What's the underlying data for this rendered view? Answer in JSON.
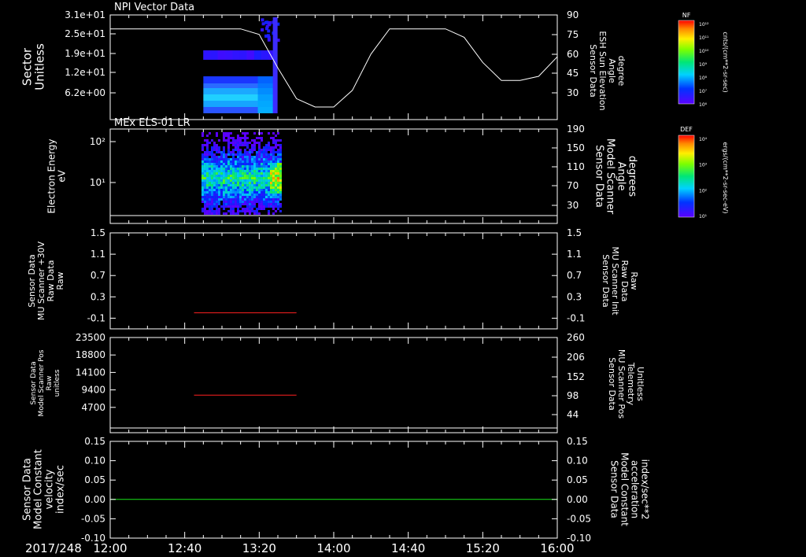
{
  "colors": {
    "white": "#ffffff",
    "red": "#ff2020",
    "green": "#19e619",
    "background": "#000000"
  },
  "time_axis": {
    "date": "2017/248",
    "ticks": [
      "12:00",
      "12:40",
      "13:20",
      "14:00",
      "14:40",
      "15:20",
      "16:00"
    ],
    "range": [
      "12:00",
      "16:00"
    ]
  },
  "chart_data": [
    {
      "type": "heatmap",
      "title": "NPI Vector Data",
      "ylabel": [
        "Sector",
        "Unitless"
      ],
      "y_ticks": [
        "3.1e+01",
        "2.5e+01",
        "1.9e+01",
        "1.2e+01",
        "6.2e+00"
      ],
      "y_range": [
        0,
        31
      ],
      "right_ylabel": [
        "Sensor Data",
        "ESH Sun Elevation",
        "Angle",
        "degree"
      ],
      "right_y_ticks": [
        "90",
        "75",
        "60",
        "45",
        "30"
      ],
      "right_y_range": [
        15,
        90
      ],
      "colorbar": {
        "label": "NF",
        "units": "cnts/(cm**2-sr-sec)",
        "ticks": [
          "10¹²",
          "10¹¹",
          "10¹⁰",
          "10⁹",
          "10⁸",
          "10⁷",
          "10⁶"
        ]
      },
      "data_time_range": [
        "12:50",
        "13:29"
      ],
      "line_series": {
        "name": "ESH Sun Elevation Angle",
        "x": [
          "12:00",
          "13:10",
          "13:20",
          "13:30",
          "13:40",
          "13:50",
          "14:00",
          "14:10",
          "14:20",
          "14:30",
          "14:40",
          "14:50",
          "15:00",
          "15:10",
          "15:20",
          "15:30",
          "15:40",
          "15:50",
          "16:00"
        ],
        "y": [
          80,
          80,
          76,
          52,
          30,
          24,
          24,
          36,
          62,
          80,
          80,
          80,
          80,
          74,
          56,
          43,
          43,
          46,
          60
        ]
      }
    },
    {
      "type": "heatmap",
      "title": "MEx ELS-01 LR",
      "ylabel": [
        "Electron Energy",
        "eV"
      ],
      "y_ticks": [
        "10²",
        "10¹"
      ],
      "right_ylabel": [
        "Sensor Data",
        "Model Scanner",
        "Angle",
        "degrees"
      ],
      "right_y_ticks": [
        "190",
        "150",
        "110",
        "70",
        "30"
      ],
      "colorbar": {
        "label": "DEF",
        "units": "ergs/(cm**2-sr-sec-eV)",
        "ticks": [
          "10⁴",
          "10³",
          "10²",
          "10¹"
        ]
      },
      "data_time_range": [
        "12:49",
        "13:32"
      ],
      "line_series": {
        "name": "Model Scanner Angle",
        "x": [
          "12:00",
          "16:00"
        ],
        "y": [
          10,
          10
        ]
      }
    },
    {
      "type": "line",
      "ylabel": [
        "Sensor Data",
        "MU Scanner +30V",
        "Raw Data",
        "Raw"
      ],
      "y_ticks": [
        "1.5",
        "1.1",
        "0.7",
        "0.3",
        "-0.1"
      ],
      "ylim": [
        -0.3,
        1.5
      ],
      "right_ylabel": [
        "Sensor Data",
        "MU Scanner Init",
        "Raw Data",
        "Raw"
      ],
      "right_y_ticks": [
        "1.5",
        "1.1",
        "0.7",
        "0.3",
        "-0.1"
      ],
      "series": [
        {
          "x": [
            "12:45",
            "13:40"
          ],
          "y": [
            0.0,
            0.0
          ]
        }
      ]
    },
    {
      "type": "line",
      "ylabel": [
        "Sensor Data",
        "Model Scanner Pos",
        "Raw",
        "unitless"
      ],
      "y_ticks": [
        "23500",
        "18800",
        "14100",
        "9400",
        "4700"
      ],
      "ylim": [
        0,
        23500
      ],
      "right_ylabel": [
        "Sensor Data",
        "MU Scanner Pos",
        "Telemetry",
        "Unitless"
      ],
      "right_y_ticks": [
        "260",
        "206",
        "152",
        "98",
        "44"
      ],
      "series": [
        {
          "x": [
            "12:45",
            "13:40"
          ],
          "y": [
            8000,
            8000
          ]
        }
      ]
    },
    {
      "type": "line",
      "ylabel": [
        "Sensor Data",
        "Model Constant",
        "velocity",
        "index/sec"
      ],
      "y_ticks": [
        "0.15",
        "0.10",
        "0.05",
        "0.00",
        "-0.05",
        "-0.10"
      ],
      "ylim": [
        -0.1,
        0.15
      ],
      "right_ylabel": [
        "Sensor Data",
        "Model Constant",
        "acceleration",
        "index/sec**2"
      ],
      "right_y_ticks": [
        "0.15",
        "0.10",
        "0.05",
        "0.00",
        "-0.05",
        "-0.10"
      ],
      "series": [
        {
          "x": [
            "12:00",
            "16:00"
          ],
          "y": [
            0.0,
            0.0
          ]
        }
      ]
    }
  ]
}
